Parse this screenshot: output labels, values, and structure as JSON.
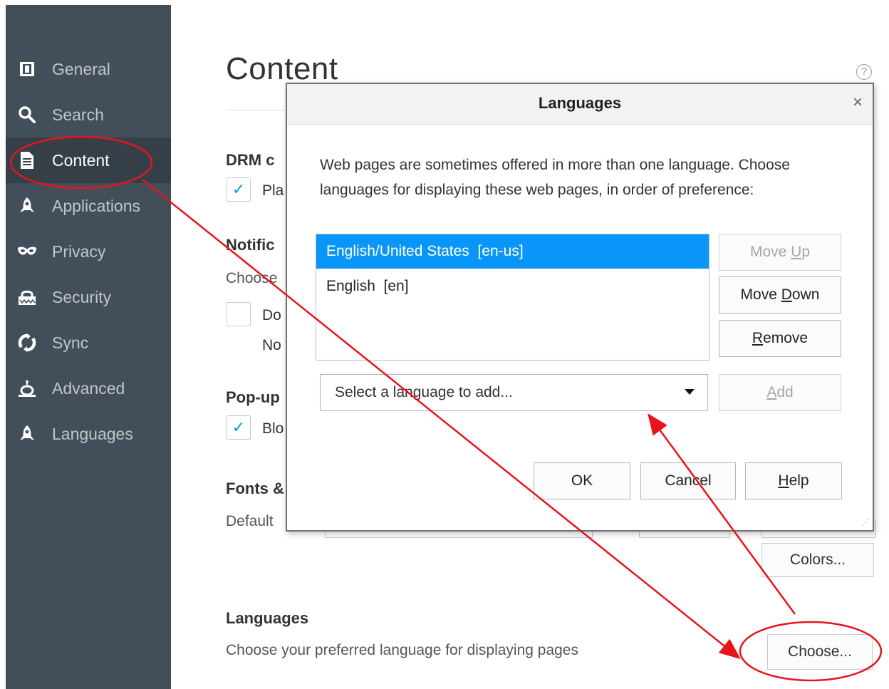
{
  "sidebar": {
    "items": [
      {
        "label": "General",
        "icon": "general-icon"
      },
      {
        "label": "Search",
        "icon": "search-icon"
      },
      {
        "label": "Content",
        "icon": "content-icon",
        "selected": true
      },
      {
        "label": "Applications",
        "icon": "applications-icon"
      },
      {
        "label": "Privacy",
        "icon": "privacy-mask-icon"
      },
      {
        "label": "Security",
        "icon": "security-lock-icon"
      },
      {
        "label": "Sync",
        "icon": "sync-icon"
      },
      {
        "label": "Advanced",
        "icon": "advanced-icon"
      },
      {
        "label": "Languages",
        "icon": "languages-icon"
      }
    ]
  },
  "main": {
    "title": "Content",
    "help_icon": "?",
    "drm": {
      "heading": "DRM c",
      "checkbox_label": "Pla",
      "checked": true
    },
    "notifications": {
      "heading": "Notific",
      "text": "Choose",
      "checkbox_label": "Do",
      "sub_text": "No",
      "checked": false
    },
    "popups": {
      "heading": "Pop-up",
      "checkbox_label": "Blo",
      "checked": true
    },
    "fonts": {
      "heading": "Fonts &",
      "default_label": "Default",
      "colors_button": "Colors..."
    },
    "languages": {
      "heading": "Languages",
      "text": "Choose your preferred language for displaying pages",
      "choose_button": "Choose..."
    }
  },
  "dialog": {
    "title": "Languages",
    "close": "×",
    "intro": "Web pages are sometimes offered in more than one language. Choose languages for displaying these web pages, in order of preference:",
    "languages": [
      "English/United States  [en-us]",
      "English  [en]"
    ],
    "selected_index": 0,
    "buttons": {
      "move_up": "Move Up",
      "move_down": "Move Down",
      "remove": "Remove",
      "add": "Add",
      "ok": "OK",
      "cancel": "Cancel",
      "help": "Help"
    },
    "select_placeholder": "Select a language to add..."
  },
  "colors": {
    "sidebar_bg": "#424f5a",
    "sidebar_selected": "#343f48",
    "accent": "#0996f8",
    "annotation": "#e8141c"
  }
}
